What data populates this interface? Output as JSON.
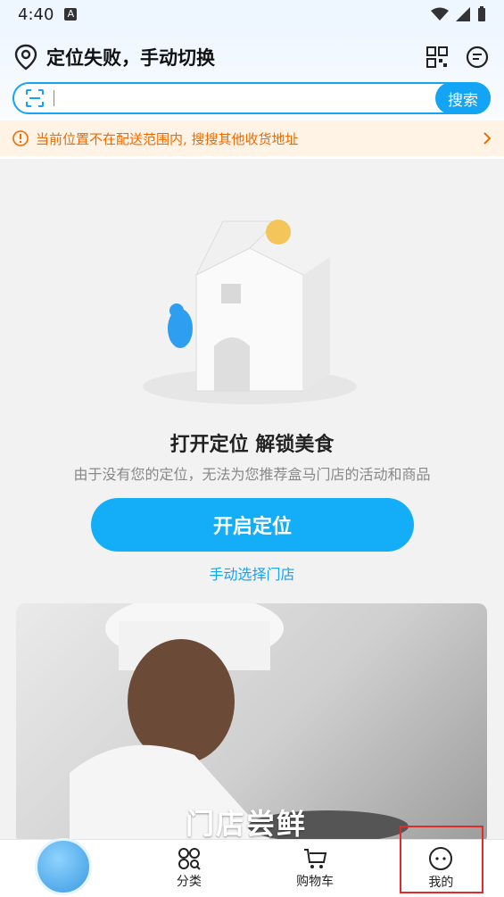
{
  "status_bar": {
    "time": "4:40",
    "notification_badge": "A"
  },
  "header": {
    "location_text": "定位失败，手动切换",
    "search": {
      "value": "",
      "placeholder": "",
      "button_label": "搜索"
    }
  },
  "warning": {
    "text": "当前位置不在配送范围内, 搜搜其他收货地址"
  },
  "main": {
    "title": "打开定位 解锁美食",
    "subtitle": "由于没有您的定位，无法为您推荐盒马门店的活动和商品",
    "enable_button": "开启定位",
    "manual_link": "手动选择门店",
    "banner_text": "门店尝鲜"
  },
  "tabs": [
    {
      "label": ""
    },
    {
      "label": "分类"
    },
    {
      "label": "购物车"
    },
    {
      "label": "我的"
    }
  ],
  "colors": {
    "accent": "#13a4f5",
    "warning": "#f06a00",
    "highlight": "#e12b2b"
  }
}
